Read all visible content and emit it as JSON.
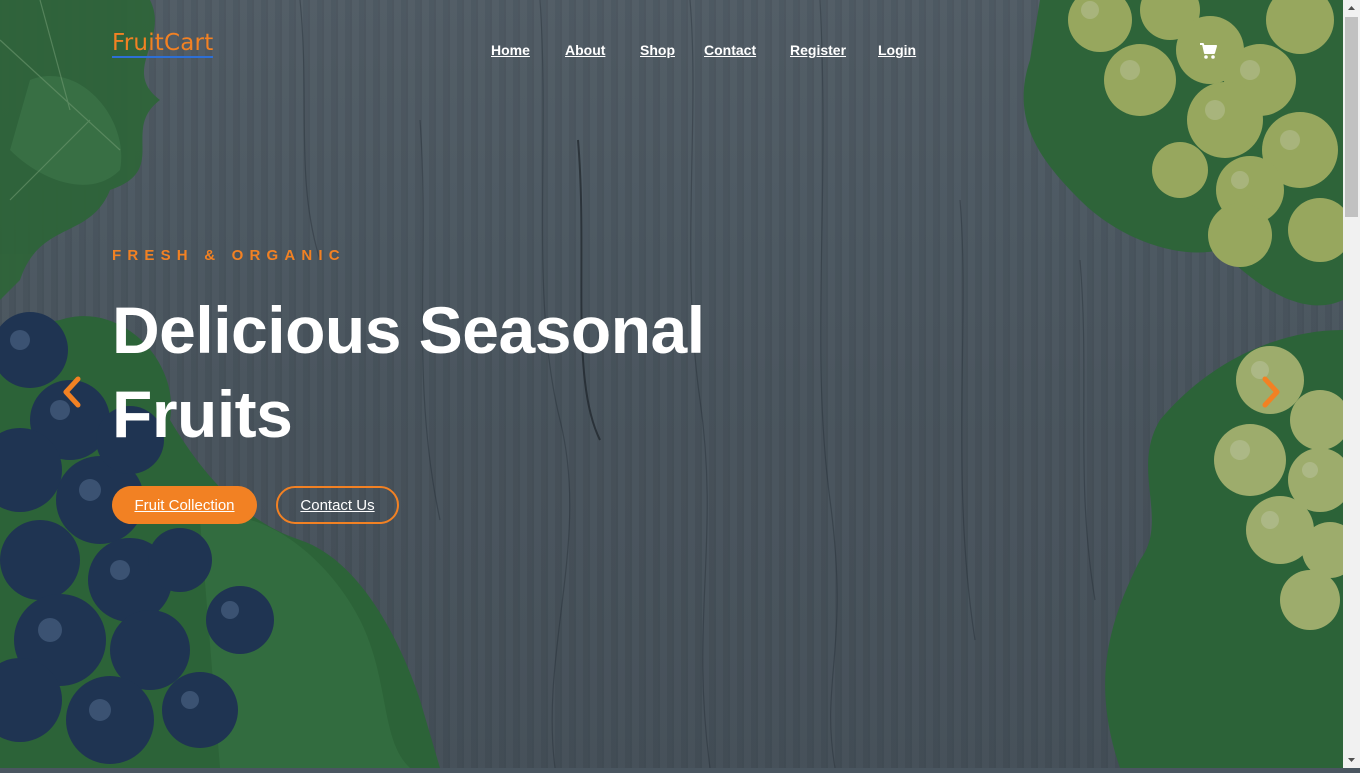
{
  "header": {
    "logo": "FruitCart",
    "nav": [
      {
        "label": "Home"
      },
      {
        "label": "About"
      },
      {
        "label": "Shop"
      },
      {
        "label": "Contact"
      },
      {
        "label": "Register"
      },
      {
        "label": "Login"
      }
    ],
    "cart_icon": "shopping-cart-icon"
  },
  "hero": {
    "subtitle": "FRESH & ORGANIC",
    "headline": "Delicious Seasonal Fruits",
    "primary_button": "Fruit Collection",
    "secondary_button": "Contact Us",
    "prev_icon": "chevron-left-icon",
    "next_icon": "chevron-right-icon"
  },
  "colors": {
    "accent": "#f28123",
    "text": "#ffffff",
    "logo_underline": "#2d6fd6"
  }
}
